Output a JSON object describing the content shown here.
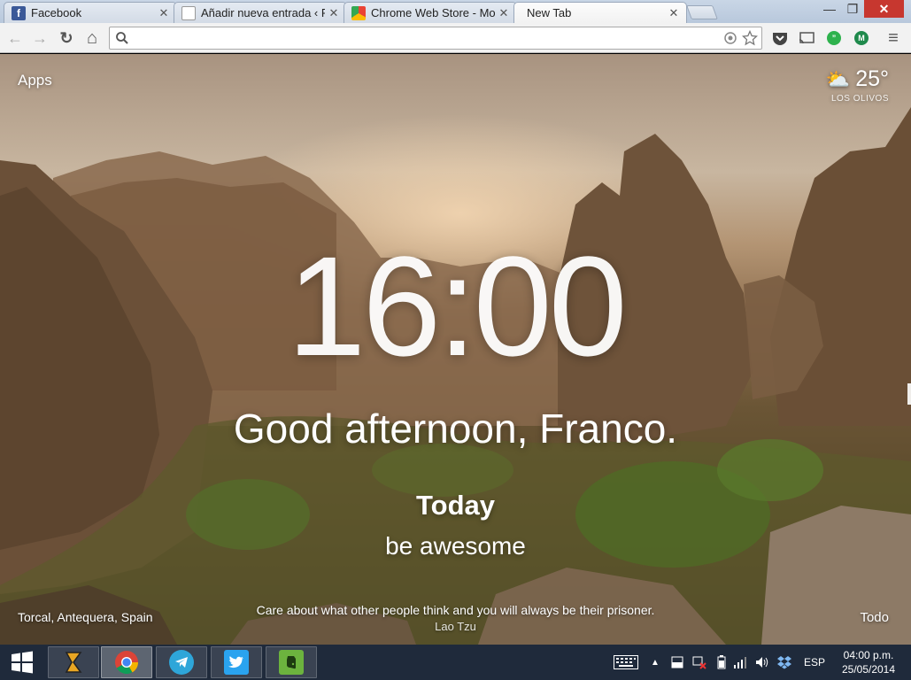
{
  "tabs": [
    {
      "title": "Facebook",
      "favicon": "facebook-icon"
    },
    {
      "title": "Añadir nueva entrada ‹ Pe",
      "favicon": "document-icon"
    },
    {
      "title": "Chrome Web Store - Mom",
      "favicon": "chrome-web-store-icon"
    },
    {
      "title": "New Tab",
      "favicon": "none",
      "active": true
    }
  ],
  "window": {
    "minimize": "—",
    "maximize": "❐",
    "close": "✕"
  },
  "toolbar": {
    "back": "←",
    "forward": "→",
    "reload": "↻",
    "home": "⌂",
    "menu": "≡"
  },
  "omnibox": {
    "value": "",
    "placeholder": ""
  },
  "page": {
    "apps_label": "Apps",
    "weather": {
      "icon": "partly-cloudy-icon",
      "temperature": "25°",
      "location": "LOS OLIVOS"
    },
    "clock": "16:00",
    "greeting": "Good afternoon, Franco.",
    "focus_label": "Today",
    "focus_text": "be awesome",
    "photo_location": "Torcal, Antequera, Spain",
    "quote": "Care about what other people think and you will always be their prisoner.",
    "quote_author": "Lao Tzu",
    "todo_label": "Todo"
  },
  "taskbar": {
    "apps": [
      "winamp-icon",
      "chrome-icon",
      "telegram-icon",
      "twitter-icon",
      "evernote-icon"
    ],
    "language": "ESP",
    "time": "04:00 p.m.",
    "date": "25/05/2014"
  },
  "colors": {
    "taskbar": "#1f2a3b",
    "close_button": "#c7372f",
    "tabstrip": "#c9d6e6"
  }
}
